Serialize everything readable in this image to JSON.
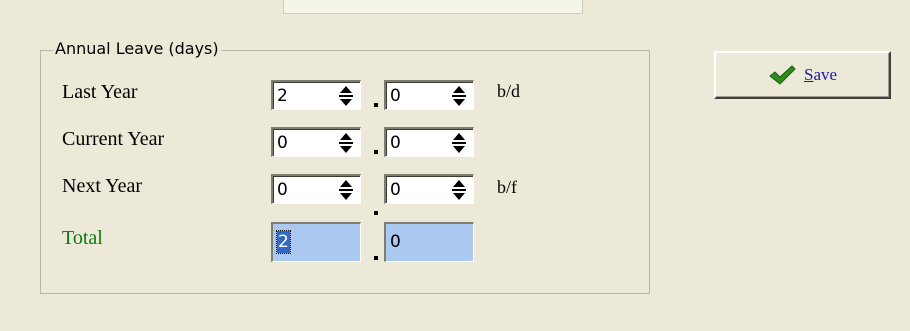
{
  "group_title": "Annual Leave (days)",
  "rows": [
    {
      "label": "Last Year",
      "whole": "2",
      "fraction": "0",
      "unit": "b/d"
    },
    {
      "label": "Current Year",
      "whole": "0",
      "fraction": "0",
      "unit": ""
    },
    {
      "label": "Next Year",
      "whole": "0",
      "fraction": "0",
      "unit": "b/f"
    }
  ],
  "total": {
    "label": "Total",
    "whole": "2",
    "fraction": "0"
  },
  "save_button": {
    "mnemonic": "S",
    "rest": "ave"
  },
  "colors": {
    "total_label": "#0a7a0a",
    "check": "#2e8b1e",
    "total_bg": "#aac8f0"
  },
  "icons": {
    "save": "checkmark-icon",
    "spinner": "spinner-arrows-icon"
  }
}
